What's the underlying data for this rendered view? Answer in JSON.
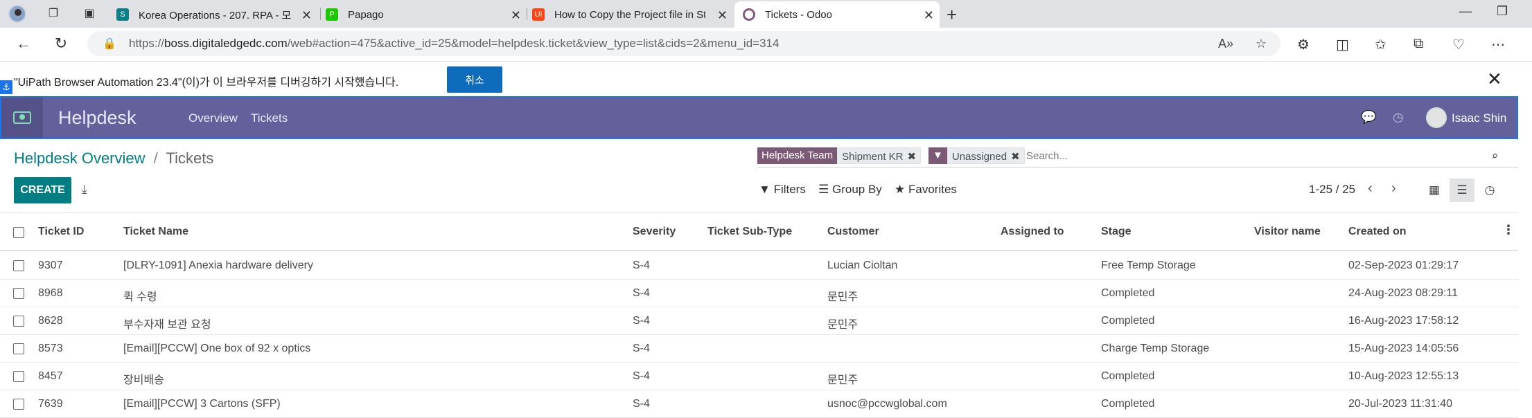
{
  "browser": {
    "tabs": [
      {
        "title": "Korea Operations - 207. RPA - 모",
        "favicon_color": "#0a7f86"
      },
      {
        "title": "Papago",
        "favicon_color": "#1ec800"
      },
      {
        "title": "How to Copy the Project file in St",
        "favicon_color": "#fa4616"
      },
      {
        "title": "Tickets - Odoo",
        "favicon_color": "#875a7b"
      }
    ],
    "url_prefix": "https://",
    "url_host": "boss.digitaledgedc.com",
    "url_path": "/web#action=475&active_id=25&model=helpdesk.ticket&view_type=list&cids=2&menu_id=314"
  },
  "notification": {
    "text": "\"UiPath Browser Automation 23.4\"(이)가 이 브라우저를 디버깅하기 시작했습니다.",
    "cancel_label": "취소"
  },
  "navbar": {
    "app_name": "Helpdesk",
    "links": [
      "Overview",
      "Tickets"
    ],
    "user_name": "Isaac Shin"
  },
  "breadcrumb": {
    "parent": "Helpdesk Overview",
    "separator": "/",
    "current": "Tickets"
  },
  "search": {
    "facets": [
      {
        "label": "Helpdesk Team",
        "value": "Shipment KR"
      },
      {
        "label": "",
        "value": "Unassigned"
      }
    ],
    "placeholder": "Search..."
  },
  "toolbar": {
    "create_label": "CREATE",
    "filters_label": "Filters",
    "groupby_label": "Group By",
    "favorites_label": "Favorites",
    "pager": "1-25 / 25"
  },
  "table": {
    "columns": [
      "Ticket ID",
      "Ticket Name",
      "Severity",
      "Ticket Sub-Type",
      "Customer",
      "Assigned to",
      "Stage",
      "Visitor name",
      "Created on"
    ],
    "rows": [
      {
        "id": "9307",
        "name": "[DLRY-1091] Anexia hardware delivery",
        "severity": "S-4",
        "subtype": "",
        "customer": "Lucian Cioltan",
        "assigned": "",
        "stage": "Free Temp Storage",
        "visitor": "",
        "created": "02-Sep-2023 01:29:17"
      },
      {
        "id": "8968",
        "name": "퀵 수령",
        "severity": "S-4",
        "subtype": "",
        "customer": "문민주",
        "assigned": "",
        "stage": "Completed",
        "visitor": "",
        "created": "24-Aug-2023 08:29:11"
      },
      {
        "id": "8628",
        "name": "부수자재 보관 요청",
        "severity": "S-4",
        "subtype": "",
        "customer": "문민주",
        "assigned": "",
        "stage": "Completed",
        "visitor": "",
        "created": "16-Aug-2023 17:58:12"
      },
      {
        "id": "8573",
        "name": "[Email][PCCW] One box of 92 x optics",
        "severity": "S-4",
        "subtype": "",
        "customer": "",
        "assigned": "",
        "stage": "Charge Temp Storage",
        "visitor": "",
        "created": "15-Aug-2023 14:05:56"
      },
      {
        "id": "8457",
        "name": "장비배송",
        "severity": "S-4",
        "subtype": "",
        "customer": "문민주",
        "assigned": "",
        "stage": "Completed",
        "visitor": "",
        "created": "10-Aug-2023 12:55:13"
      },
      {
        "id": "7639",
        "name": "[Email][PCCW] 3 Cartons (SFP)",
        "severity": "S-4",
        "subtype": "",
        "customer": "usnoc@pccwglobal.com",
        "assigned": "",
        "stage": "Completed",
        "visitor": "",
        "created": "20-Jul-2023 11:31:40"
      }
    ]
  }
}
